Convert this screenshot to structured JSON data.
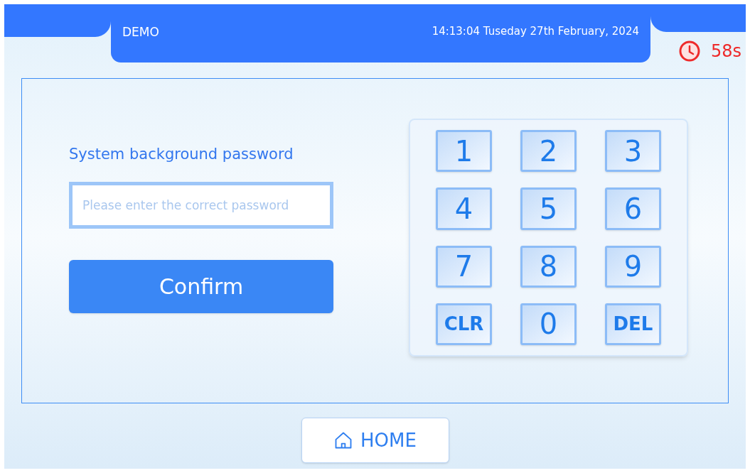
{
  "header": {
    "title": "DEMO",
    "datetime": "14:13:04 Tuseday 27th February, 2024"
  },
  "timer": {
    "text": "58s"
  },
  "login": {
    "label": "System background password",
    "placeholder": "Please enter the correct password",
    "confirm": "Confirm"
  },
  "keypad": {
    "keys": [
      {
        "label": "1",
        "kind": "digit"
      },
      {
        "label": "2",
        "kind": "digit"
      },
      {
        "label": "3",
        "kind": "digit"
      },
      {
        "label": "4",
        "kind": "digit"
      },
      {
        "label": "5",
        "kind": "digit"
      },
      {
        "label": "6",
        "kind": "digit"
      },
      {
        "label": "7",
        "kind": "digit"
      },
      {
        "label": "8",
        "kind": "digit"
      },
      {
        "label": "9",
        "kind": "digit"
      },
      {
        "label": "CLR",
        "kind": "action"
      },
      {
        "label": "0",
        "kind": "digit"
      },
      {
        "label": "DEL",
        "kind": "action"
      }
    ]
  },
  "home": {
    "label": "HOME"
  }
}
